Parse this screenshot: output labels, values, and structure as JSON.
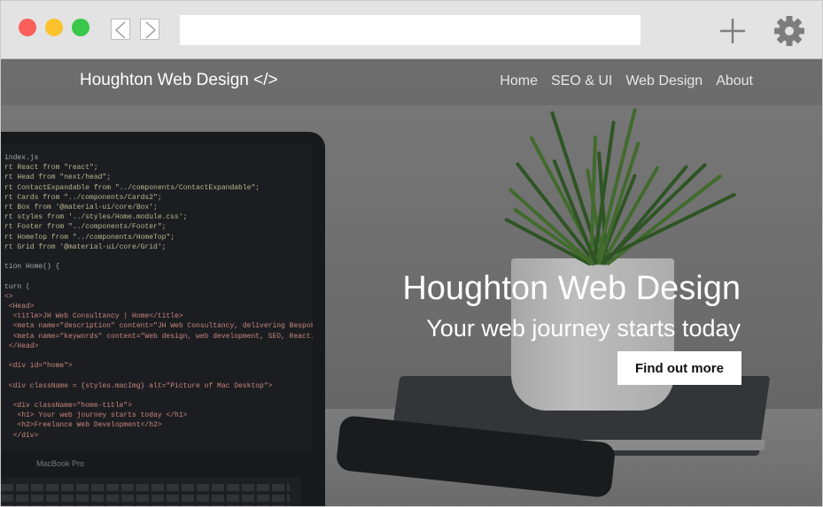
{
  "browser": {
    "url_value": "",
    "back_icon": "chevron-left-icon",
    "forward_icon": "chevron-right-icon",
    "new_tab_icon": "plus-icon",
    "settings_icon": "gear-icon",
    "traffic_light_colors": [
      "#fb5f5a",
      "#fcc22e",
      "#38c84a"
    ]
  },
  "site": {
    "brand": "Houghton Web Design </>",
    "nav": [
      "Home",
      "SEO & UI",
      "Web Design",
      "About"
    ]
  },
  "hero": {
    "title": "Houghton Web Design",
    "subtitle": "Your web journey starts today",
    "cta_label": "Find out more"
  },
  "laptop": {
    "brand_label": "MacBook Pro",
    "code_lines": [
      "index.js",
      "rt React from \"react\";",
      "rt Head from \"next/head\";",
      "rt ContactExpandable from \"../components/ContactExpandable\";",
      "rt Cards from \"../components/Cards2\";",
      "rt Box from '@material-ui/core/Box';",
      "rt styles from '../styles/Home.module.css';",
      "rt Footer from \"../components/Footer\";",
      "rt HomeTop from \"../components/HomeTop\";",
      "rt Grid from '@material-ui/core/Grid';",
      "",
      "tion Home() {",
      "",
      "turn (",
      "<>",
      " <Head>",
      "  <title>JH Web Consultancy | Home</title>",
      "  <meta name=\"description\" content=\"JH Web Consultancy, delivering Bespoke Web",
      "  <meta name=\"keywords\" content=\"Web design, web development, SEO, React.js, n",
      " </Head>",
      "",
      " <div id=\"home\">",
      "",
      " <div className = {styles.macImg} alt=\"Picture of Mac Desktop\">",
      "",
      "  <div className=\"home-title\">",
      "   <h1> Your web journey starts today </h1>",
      "   <h2>Freelance Web Development</h2>",
      "  </div>"
    ]
  }
}
